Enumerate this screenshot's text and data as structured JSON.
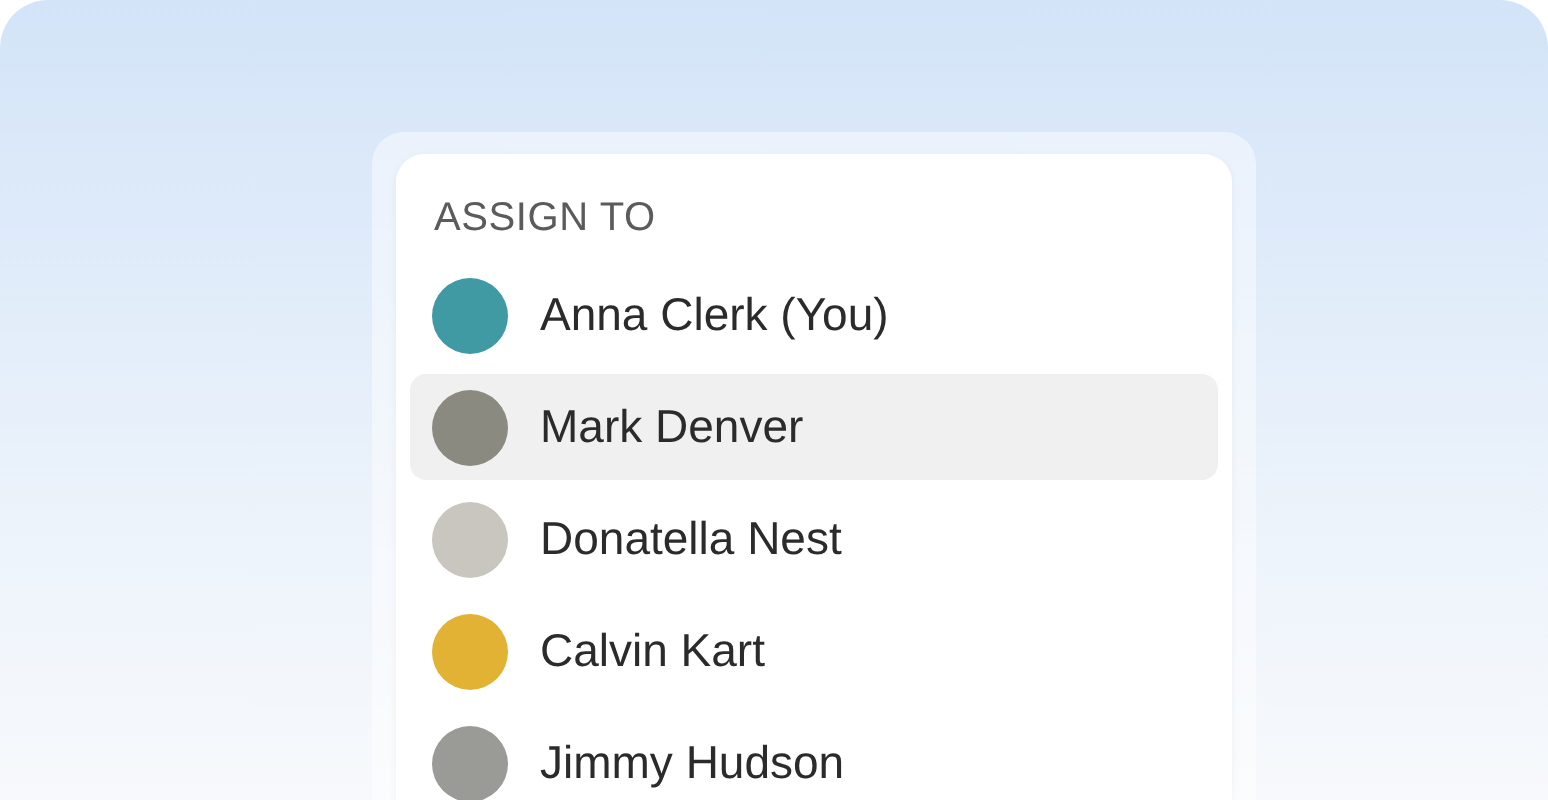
{
  "header": "ASSIGN TO",
  "people": [
    {
      "name": "Anna Clerk (You)",
      "selected": false,
      "color": "#3f9aa3"
    },
    {
      "name": "Mark Denver",
      "selected": true,
      "color": "#8a8a80"
    },
    {
      "name": "Donatella Nest",
      "selected": false,
      "color": "#c9c6c0"
    },
    {
      "name": "Calvin Kart",
      "selected": false,
      "color": "#e2b234"
    },
    {
      "name": "Jimmy Hudson",
      "selected": false,
      "color": "#9a9a96"
    }
  ]
}
